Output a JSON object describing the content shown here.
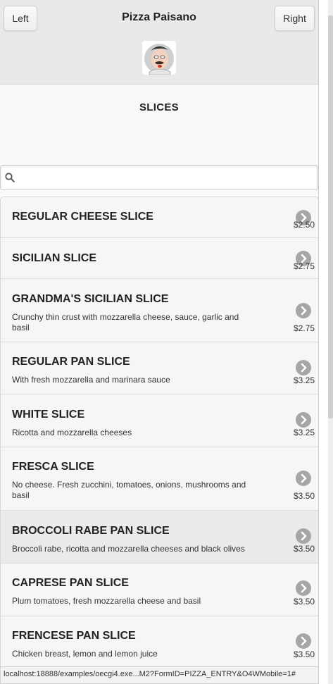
{
  "header": {
    "left_label": "Left",
    "title": "Pizza Paisano",
    "right_label": "Right"
  },
  "section": {
    "title": "SLICES"
  },
  "search": {
    "value": "",
    "placeholder": ""
  },
  "items": [
    {
      "name": "REGULAR CHEESE SLICE",
      "description": "",
      "price": "$2.50"
    },
    {
      "name": "SICILIAN SLICE",
      "description": "",
      "price": "$2.75"
    },
    {
      "name": "GRANDMA'S SICILIAN SLICE",
      "description": "Crunchy thin crust with mozzarella cheese, sauce, garlic and basil",
      "price": "$2.75"
    },
    {
      "name": "REGULAR PAN SLICE",
      "description": "With fresh mozzarella and marinara sauce",
      "price": "$3.25"
    },
    {
      "name": "WHITE SLICE",
      "description": "Ricotta and mozzarella cheeses",
      "price": "$3.25"
    },
    {
      "name": "FRESCA SLICE",
      "description": "No cheese. Fresh zucchini, tomatoes, onions, mushrooms and basil",
      "price": "$3.50"
    },
    {
      "name": "BROCCOLI RABE PAN SLICE",
      "description": "Broccoli rabe, ricotta and mozzarella cheeses and black olives",
      "price": "$3.50"
    },
    {
      "name": "CAPRESE PAN SLICE",
      "description": "Plum tomatoes, fresh mozzarella cheese and basil",
      "price": "$3.50"
    },
    {
      "name": "FRENCESE PAN SLICE",
      "description": "Chicken breast, lemon and lemon juice",
      "price": "$3.50"
    }
  ],
  "status_url": "localhost:18888/examples/oecgi4.exe...M2?FormID=PIZZA_ENTRY&O4WMobile=1#",
  "icons": {
    "search": "search-icon",
    "arrow": "chevron-right-icon",
    "logo": "chef-logo"
  },
  "colors": {
    "header_bg": "#e9e9e9",
    "list_bg": "#f6f6f6",
    "arrow_bg": "#a6a6a6",
    "active_row": "#ebebeb"
  }
}
